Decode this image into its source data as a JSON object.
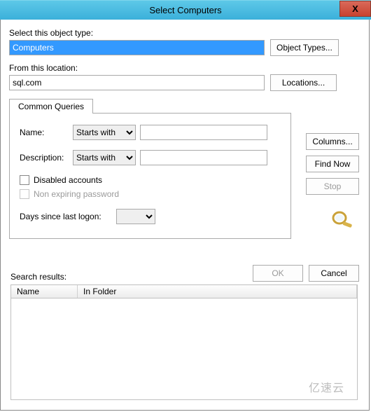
{
  "title": "Select Computers",
  "closeGlyph": "X",
  "objectType": {
    "label": "Select this object type:",
    "value": "Computers",
    "button": "Object Types..."
  },
  "location": {
    "label": "From this location:",
    "value": "sql.com",
    "button": "Locations..."
  },
  "tab": {
    "label": "Common Queries",
    "nameLabel": "Name:",
    "descLabel": "Description:",
    "startsWith": "Starts with",
    "nameValue": "",
    "descValue": "",
    "disabledAccounts": "Disabled accounts",
    "nonExpiring": "Non expiring password",
    "daysLabel": "Days since last logon:",
    "daysValue": ""
  },
  "sideButtons": {
    "columns": "Columns...",
    "findNow": "Find Now",
    "stop": "Stop"
  },
  "okcancel": {
    "ok": "OK",
    "cancel": "Cancel"
  },
  "results": {
    "label": "Search results:",
    "colName": "Name",
    "colFolder": "In Folder"
  },
  "watermark": "亿速云"
}
